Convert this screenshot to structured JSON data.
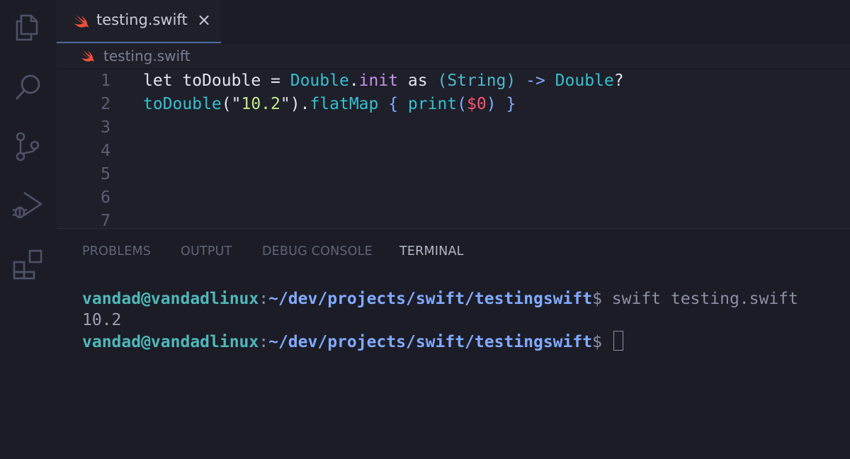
{
  "activity_bar": {
    "icons": [
      "files-icon",
      "search-icon",
      "source-control-icon",
      "run-debug-icon",
      "extensions-icon"
    ]
  },
  "editor": {
    "tab": {
      "label": "testing.swift",
      "close": "×",
      "icon": "swift-icon"
    },
    "breadcrumb": {
      "label": "testing.swift",
      "icon": "swift-icon"
    },
    "lines": [
      {
        "num": "1",
        "tokens": [
          {
            "t": "let ",
            "c": "kw"
          },
          {
            "t": "toDouble",
            "c": "id"
          },
          {
            "t": " = ",
            "c": "id"
          },
          {
            "t": "Double",
            "c": "cyan"
          },
          {
            "t": ".",
            "c": "id"
          },
          {
            "t": "init",
            "c": "fn"
          },
          {
            "t": " as ",
            "c": "kw"
          },
          {
            "t": "(",
            "c": "ty"
          },
          {
            "t": "String",
            "c": "ty"
          },
          {
            "t": ")",
            "c": "ty"
          },
          {
            "t": " -> ",
            "c": "blue"
          },
          {
            "t": "Double",
            "c": "cyan"
          },
          {
            "t": "?",
            "c": "id"
          }
        ]
      },
      {
        "num": "2",
        "tokens": [
          {
            "t": "toDouble",
            "c": "cyan"
          },
          {
            "t": "(\"",
            "c": "id"
          },
          {
            "t": "10.2",
            "c": "st"
          },
          {
            "t": "\")",
            "c": "id"
          },
          {
            "t": ".",
            "c": "id"
          },
          {
            "t": "flatMap",
            "c": "cyan"
          },
          {
            "t": " { ",
            "c": "blue"
          },
          {
            "t": "print",
            "c": "cyan"
          },
          {
            "t": "(",
            "c": "blue"
          },
          {
            "t": "$0",
            "c": "var"
          },
          {
            "t": ")",
            "c": "blue"
          },
          {
            "t": " }",
            "c": "blue"
          }
        ]
      },
      {
        "num": "3",
        "tokens": []
      },
      {
        "num": "4",
        "tokens": []
      },
      {
        "num": "5",
        "tokens": []
      },
      {
        "num": "6",
        "tokens": []
      },
      {
        "num": "7",
        "tokens": []
      }
    ]
  },
  "panel": {
    "tabs": [
      {
        "label": "PROBLEMS",
        "active": false
      },
      {
        "label": "OUTPUT",
        "active": false
      },
      {
        "label": "DEBUG CONSOLE",
        "active": false
      },
      {
        "label": "TERMINAL",
        "active": true
      }
    ],
    "terminal": {
      "prompt_user": "vandad@vandadlinux",
      "prompt_sep": ":",
      "prompt_path": "~/dev/projects/swift/testingswift",
      "prompt_end": "$",
      "command": " swift testing.swift",
      "output": "10.2"
    }
  },
  "colors": {
    "background": "#1b1c26",
    "editor_background": "#1e1f29",
    "tab_active_border": "#4d6ea3",
    "swift_orange": "#f05138"
  }
}
